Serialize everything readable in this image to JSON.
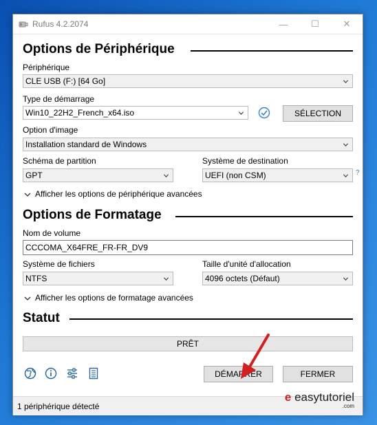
{
  "window": {
    "title": "Rufus 4.2.2074",
    "minimize": "—",
    "maximize": "☐",
    "close": "✕"
  },
  "device_section": {
    "title": "Options de Périphérique",
    "device_label": "Périphérique",
    "device_value": "CLE USB (F:) [64 Go]",
    "boot_label": "Type de démarrage",
    "boot_value": "Win10_22H2_French_x64.iso",
    "select_button": "SÉLECTION",
    "image_label": "Option d'image",
    "image_value": "Installation standard de Windows",
    "partition_label": "Schéma de partition",
    "partition_value": "GPT",
    "target_label": "Système de destination",
    "target_value": "UEFI (non CSM)",
    "help_mark": "?",
    "advanced_toggle": "Afficher les options de périphérique avancées"
  },
  "format_section": {
    "title": "Options de Formatage",
    "volume_label": "Nom de volume",
    "volume_value": "CCCOMA_X64FRE_FR-FR_DV9",
    "fs_label": "Système de fichiers",
    "fs_value": "NTFS",
    "cluster_label": "Taille d'unité d'allocation",
    "cluster_value": "4096 octets (Défaut)",
    "advanced_toggle": "Afficher les options de formatage avancées"
  },
  "status_section": {
    "title": "Statut",
    "progress_text": "PRÊT",
    "progress": 0
  },
  "actions": {
    "start": "DÉMARRER",
    "close": "FERMER"
  },
  "footer": {
    "status": "1 périphérique détecté"
  },
  "watermark": {
    "brand": "easytutoriel",
    "domain": ".com"
  }
}
